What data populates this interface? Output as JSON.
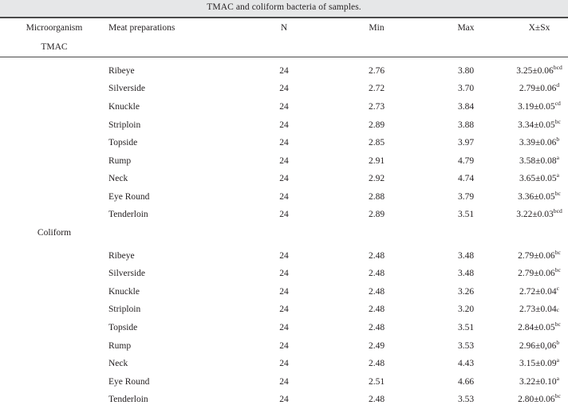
{
  "title": "TMAC and coliform bacteria of samples.",
  "columns": {
    "microorganism": "Microorganism",
    "meat_preparations": "Meat preparations",
    "n": "N",
    "min": "Min",
    "max": "Max",
    "mean": "X±Sx"
  },
  "groups": [
    {
      "name": "TMAC",
      "rows": [
        {
          "meat": "Ribeye",
          "n": "24",
          "min": "2.76",
          "max": "3.80",
          "mean": "3.25±0.06",
          "sup": "bcd",
          "sup_style": "super"
        },
        {
          "meat": "Silverside",
          "n": "24",
          "min": "2.72",
          "max": "3.70",
          "mean": "2.79±0.06",
          "sup": "d",
          "sup_style": "super"
        },
        {
          "meat": "Knuckle",
          "n": "24",
          "min": "2.73",
          "max": "3.84",
          "mean": "3.19±0.05",
          "sup": "cd",
          "sup_style": "super"
        },
        {
          "meat": "Striploin",
          "n": "24",
          "min": "2.89",
          "max": "3.88",
          "mean": "3.34±0.05",
          "sup": "bc",
          "sup_style": "super"
        },
        {
          "meat": "Topside",
          "n": "24",
          "min": "2.85",
          "max": "3.97",
          "mean": "3.39±0.06",
          "sup": "b",
          "sup_style": "super"
        },
        {
          "meat": "Rump",
          "n": "24",
          "min": "2.91",
          "max": "4.79",
          "mean": "3.58±0.08",
          "sup": "a",
          "sup_style": "super"
        },
        {
          "meat": "Neck",
          "n": "24",
          "min": "2.92",
          "max": "4.74",
          "mean": "3.65±0.05",
          "sup": "a",
          "sup_style": "super"
        },
        {
          "meat": "Eye Round",
          "n": "24",
          "min": "2.88",
          "max": "3.79",
          "mean": "3.36±0.05",
          "sup": "bc",
          "sup_style": "super"
        },
        {
          "meat": "Tenderloin",
          "n": "24",
          "min": "2.89",
          "max": "3.51",
          "mean": "3.22±0.03",
          "sup": "bcd",
          "sup_style": "super"
        }
      ]
    },
    {
      "name": "Coliform",
      "rows": [
        {
          "meat": "Ribeye",
          "n": "24",
          "min": "2.48",
          "max": "3.48",
          "mean": "2.79±0.06",
          "sup": "bc",
          "sup_style": "super"
        },
        {
          "meat": "Silverside",
          "n": "24",
          "min": "2.48",
          "max": "3.48",
          "mean": "2.79±0.06",
          "sup": "bc",
          "sup_style": "super"
        },
        {
          "meat": "Knuckle",
          "n": "24",
          "min": "2.48",
          "max": "3.26",
          "mean": "2.72±0.04",
          "sup": "c",
          "sup_style": "super"
        },
        {
          "meat": "Striploin",
          "n": "24",
          "min": "2.48",
          "max": "3.20",
          "mean": "2.73±0.04",
          "sup": "c",
          "sup_style": "baseline"
        },
        {
          "meat": "Topside",
          "n": "24",
          "min": "2.48",
          "max": "3.51",
          "mean": "2.84±0.05",
          "sup": "bc",
          "sup_style": "super"
        },
        {
          "meat": "Rump",
          "n": "24",
          "min": "2.49",
          "max": "3.53",
          "mean": "2.96±0,06",
          "sup": "b",
          "sup_style": "super"
        },
        {
          "meat": "Neck",
          "n": "24",
          "min": "2.48",
          "max": "4.43",
          "mean": "3.15±0.09",
          "sup": "a",
          "sup_style": "super"
        },
        {
          "meat": "Eye Round",
          "n": "24",
          "min": "2.51",
          "max": "4.66",
          "mean": "3.22±0.10",
          "sup": "a",
          "sup_style": "super"
        },
        {
          "meat": "Tenderloin",
          "n": "24",
          "min": "2.48",
          "max": "3.53",
          "mean": "2.80±0.06",
          "sup": "bc",
          "sup_style": "super"
        }
      ]
    }
  ]
}
